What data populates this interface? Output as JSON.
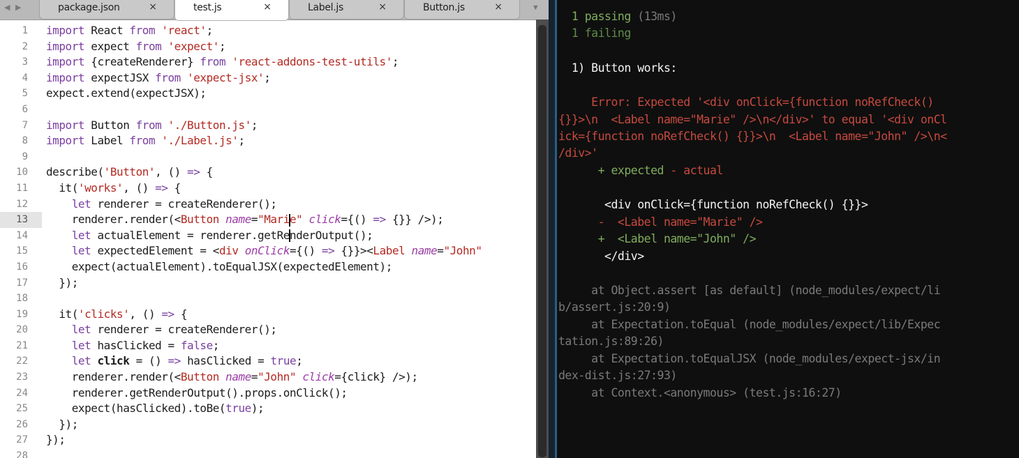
{
  "editor": {
    "tabs": [
      {
        "label": "package.json",
        "close": "×",
        "active": false
      },
      {
        "label": "test.js",
        "close": "×",
        "active": true
      },
      {
        "label": "Label.js",
        "close": "×",
        "active": false
      },
      {
        "label": "Button.js",
        "close": "×",
        "active": false
      }
    ],
    "current_line": 13,
    "line_numbers": [
      "1",
      "2",
      "3",
      "4",
      "5",
      "6",
      "7",
      "8",
      "9",
      "10",
      "11",
      "12",
      "13",
      "14",
      "15",
      "16",
      "17",
      "18",
      "19",
      "20",
      "21",
      "22",
      "23",
      "24",
      "25",
      "26",
      "27",
      "28"
    ],
    "lines": [
      [
        {
          "t": "import",
          "c": "k"
        },
        {
          "t": " React "
        },
        {
          "t": "from",
          "c": "k"
        },
        {
          "t": " "
        },
        {
          "t": "'react'",
          "c": "s"
        },
        {
          "t": ";"
        }
      ],
      [
        {
          "t": "import",
          "c": "k"
        },
        {
          "t": " expect "
        },
        {
          "t": "from",
          "c": "k"
        },
        {
          "t": " "
        },
        {
          "t": "'expect'",
          "c": "s"
        },
        {
          "t": ";"
        }
      ],
      [
        {
          "t": "import",
          "c": "k"
        },
        {
          "t": " {createRenderer} "
        },
        {
          "t": "from",
          "c": "k"
        },
        {
          "t": " "
        },
        {
          "t": "'react-addons-test-utils'",
          "c": "s"
        },
        {
          "t": ";"
        }
      ],
      [
        {
          "t": "import",
          "c": "k"
        },
        {
          "t": " expectJSX "
        },
        {
          "t": "from",
          "c": "k"
        },
        {
          "t": " "
        },
        {
          "t": "'expect-jsx'",
          "c": "s"
        },
        {
          "t": ";"
        }
      ],
      [
        {
          "t": "expect.extend(expectJSX);"
        }
      ],
      [],
      [
        {
          "t": "import",
          "c": "k"
        },
        {
          "t": " Button "
        },
        {
          "t": "from",
          "c": "k"
        },
        {
          "t": " "
        },
        {
          "t": "'./Button.js'",
          "c": "s"
        },
        {
          "t": ";"
        }
      ],
      [
        {
          "t": "import",
          "c": "k"
        },
        {
          "t": " Label "
        },
        {
          "t": "from",
          "c": "k"
        },
        {
          "t": " "
        },
        {
          "t": "'./Label.js'",
          "c": "s"
        },
        {
          "t": ";"
        }
      ],
      [],
      [
        {
          "t": "describe("
        },
        {
          "t": "'Button'",
          "c": "s"
        },
        {
          "t": ", () "
        },
        {
          "t": "=>",
          "c": "k"
        },
        {
          "t": " {"
        }
      ],
      [
        {
          "t": "  it("
        },
        {
          "t": "'works'",
          "c": "s"
        },
        {
          "t": ", () "
        },
        {
          "t": "=>",
          "c": "k"
        },
        {
          "t": " {"
        }
      ],
      [
        {
          "t": "    "
        },
        {
          "t": "let",
          "c": "k"
        },
        {
          "t": " renderer = createRenderer();"
        }
      ],
      [
        {
          "t": "    renderer.render(<"
        },
        {
          "t": "Button",
          "c": "s"
        },
        {
          "t": " "
        },
        {
          "t": "name",
          "c": "a"
        },
        {
          "t": "="
        },
        {
          "t": "\"Mari",
          "c": "s"
        },
        {
          "t": "",
          "cursor": true
        },
        {
          "t": "e\"",
          "c": "s"
        },
        {
          "t": " "
        },
        {
          "t": "click",
          "c": "a"
        },
        {
          "t": "={() "
        },
        {
          "t": "=>",
          "c": "k"
        },
        {
          "t": " {}} />);"
        }
      ],
      [
        {
          "t": "    "
        },
        {
          "t": "let",
          "c": "k"
        },
        {
          "t": " actualElement = renderer.getRe"
        },
        {
          "t": "",
          "cursor": true
        },
        {
          "t": "nderOutput();"
        }
      ],
      [
        {
          "t": "    "
        },
        {
          "t": "let",
          "c": "k"
        },
        {
          "t": " expectedElement = <"
        },
        {
          "t": "div",
          "c": "s"
        },
        {
          "t": " "
        },
        {
          "t": "onClick",
          "c": "a"
        },
        {
          "t": "={() "
        },
        {
          "t": "=>",
          "c": "k"
        },
        {
          "t": " {}}><"
        },
        {
          "t": "Label",
          "c": "s"
        },
        {
          "t": " "
        },
        {
          "t": "name",
          "c": "a"
        },
        {
          "t": "="
        },
        {
          "t": "\"John\"",
          "c": "s"
        }
      ],
      [
        {
          "t": "    expect(actualElement).toEqualJSX(expectedElement);"
        }
      ],
      [
        {
          "t": "  });"
        }
      ],
      [],
      [
        {
          "t": "  it("
        },
        {
          "t": "'clicks'",
          "c": "s"
        },
        {
          "t": ", () "
        },
        {
          "t": "=>",
          "c": "k"
        },
        {
          "t": " {"
        }
      ],
      [
        {
          "t": "    "
        },
        {
          "t": "let",
          "c": "k"
        },
        {
          "t": " renderer = createRenderer();"
        }
      ],
      [
        {
          "t": "    "
        },
        {
          "t": "let",
          "c": "k"
        },
        {
          "t": " hasClicked = "
        },
        {
          "t": "false",
          "c": "k"
        },
        {
          "t": ";"
        }
      ],
      [
        {
          "t": "    "
        },
        {
          "t": "let",
          "c": "k"
        },
        {
          "t": " "
        },
        {
          "t": "click",
          "c": "b"
        },
        {
          "t": " = () "
        },
        {
          "t": "=>",
          "c": "k"
        },
        {
          "t": " hasClicked = "
        },
        {
          "t": "true",
          "c": "k"
        },
        {
          "t": ";"
        }
      ],
      [
        {
          "t": "    renderer.render(<"
        },
        {
          "t": "Button",
          "c": "s"
        },
        {
          "t": " "
        },
        {
          "t": "name",
          "c": "a"
        },
        {
          "t": "="
        },
        {
          "t": "\"John\"",
          "c": "s"
        },
        {
          "t": " "
        },
        {
          "t": "click",
          "c": "a"
        },
        {
          "t": "={click} />);"
        }
      ],
      [
        {
          "t": "    renderer.getRenderOutput().props.onClick();"
        }
      ],
      [
        {
          "t": "    expect(hasClicked).toBe("
        },
        {
          "t": "true",
          "c": "k"
        },
        {
          "t": ");"
        }
      ],
      [
        {
          "t": "  });"
        }
      ],
      [
        {
          "t": "});"
        }
      ],
      []
    ]
  },
  "terminal": {
    "lines": [
      {
        "text": "  1 passing (13ms)",
        "parts": [
          {
            "t": "  1 passing ",
            "c": "g"
          },
          {
            "t": "(13ms)",
            "c": "gr"
          }
        ]
      },
      {
        "text": "  1 failing",
        "parts": [
          {
            "t": "  1 failing",
            "c": "dg"
          }
        ]
      },
      {
        "text": "",
        "parts": []
      },
      {
        "text": "  1) Button works:",
        "parts": [
          {
            "t": "  1) Button works:",
            "c": "w"
          }
        ]
      },
      {
        "text": "",
        "parts": []
      },
      {
        "text": "     Error: Expected '<div onClick={function noRefCheck() ",
        "parts": [
          {
            "t": "     Error: Expected '<div onClick={function noRefCheck() ",
            "c": "r"
          }
        ]
      },
      {
        "text": "{}}>\\n  <Label name=\"Marie\" />\\n</div>' to equal '<div onCl",
        "parts": [
          {
            "t": "{}}>\\n  <Label name=\"Marie\" />\\n</div>' to equal '<div onCl",
            "c": "r"
          }
        ]
      },
      {
        "text": "ick={function noRefCheck() {}}>\\n  <Label name=\"John\" />\\n<",
        "parts": [
          {
            "t": "ick={function noRefCheck() {}}>\\n  <Label name=\"John\" />\\n<",
            "c": "r"
          }
        ]
      },
      {
        "text": "/div>'",
        "parts": [
          {
            "t": "/div>'",
            "c": "r"
          }
        ]
      },
      {
        "text": "      + expected - actual",
        "parts": [
          {
            "t": "      + expected ",
            "c": "g"
          },
          {
            "t": "- actual",
            "c": "r"
          }
        ]
      },
      {
        "text": "",
        "parts": []
      },
      {
        "text": "       <div onClick={function noRefCheck() {}}>",
        "parts": [
          {
            "t": "       <div onClick={function noRefCheck() {}}>",
            "c": "w"
          }
        ]
      },
      {
        "text": "      -  <Label name=\"Marie\" />",
        "parts": [
          {
            "t": "      -  <Label name=\"Marie\" />",
            "c": "r"
          }
        ]
      },
      {
        "text": "      +  <Label name=\"John\" />",
        "parts": [
          {
            "t": "      +  <Label name=\"John\" />",
            "c": "g"
          }
        ]
      },
      {
        "text": "       </div>",
        "parts": [
          {
            "t": "       </div>",
            "c": "w"
          }
        ]
      },
      {
        "text": "",
        "parts": []
      },
      {
        "text": "     at Object.assert [as default] (node_modules/expect/li",
        "parts": [
          {
            "t": "     at Object.assert [as default] (node_modules/expect/li",
            "c": "gr"
          }
        ]
      },
      {
        "text": "b/assert.js:20:9)",
        "parts": [
          {
            "t": "b/assert.js:20:9)",
            "c": "gr"
          }
        ]
      },
      {
        "text": "     at Expectation.toEqual (node_modules/expect/lib/Expec",
        "parts": [
          {
            "t": "     at Expectation.toEqual (node_modules/expect/lib/Expec",
            "c": "gr"
          }
        ]
      },
      {
        "text": "tation.js:89:26)",
        "parts": [
          {
            "t": "tation.js:89:26)",
            "c": "gr"
          }
        ]
      },
      {
        "text": "     at Expectation.toEqualJSX (node_modules/expect-jsx/in",
        "parts": [
          {
            "t": "     at Expectation.toEqualJSX (node_modules/expect-jsx/in",
            "c": "gr"
          }
        ]
      },
      {
        "text": "dex-dist.js:27:93)",
        "parts": [
          {
            "t": "dex-dist.js:27:93)",
            "c": "gr"
          }
        ]
      },
      {
        "text": "     at Context.<anonymous> (test.js:16:27)",
        "parts": [
          {
            "t": "     at Context.<anonymous> (test.js:16:27)",
            "c": "gr"
          }
        ]
      }
    ]
  }
}
